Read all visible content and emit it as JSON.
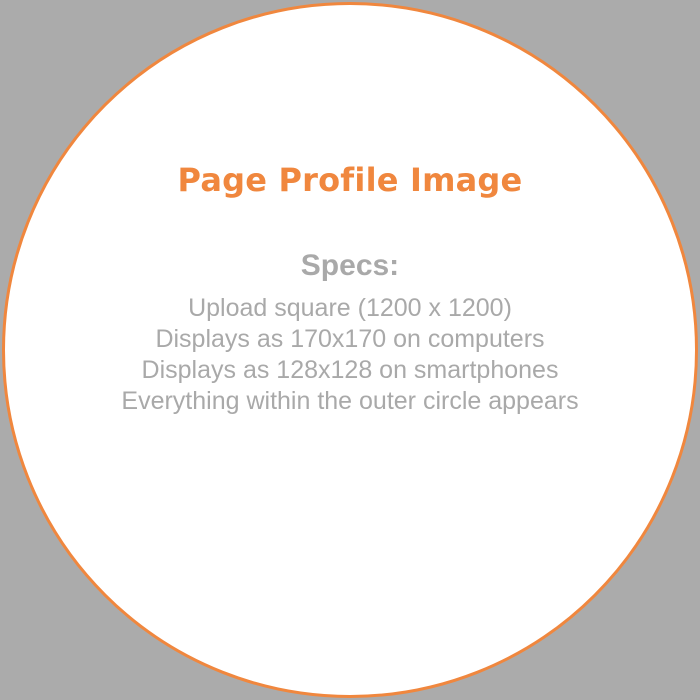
{
  "title": "Page Profile Image",
  "specs": {
    "heading": "Specs:",
    "lines": [
      "Upload square (1200 x 1200)",
      "Displays as 170x170 on computers",
      "Displays as 128x128 on smartphones",
      "Everything within the outer circle appears"
    ]
  },
  "colors": {
    "accent": "#f0873e",
    "text_muted": "#a9a9a9",
    "background": "#ababab",
    "circle_fill": "#ffffff"
  }
}
